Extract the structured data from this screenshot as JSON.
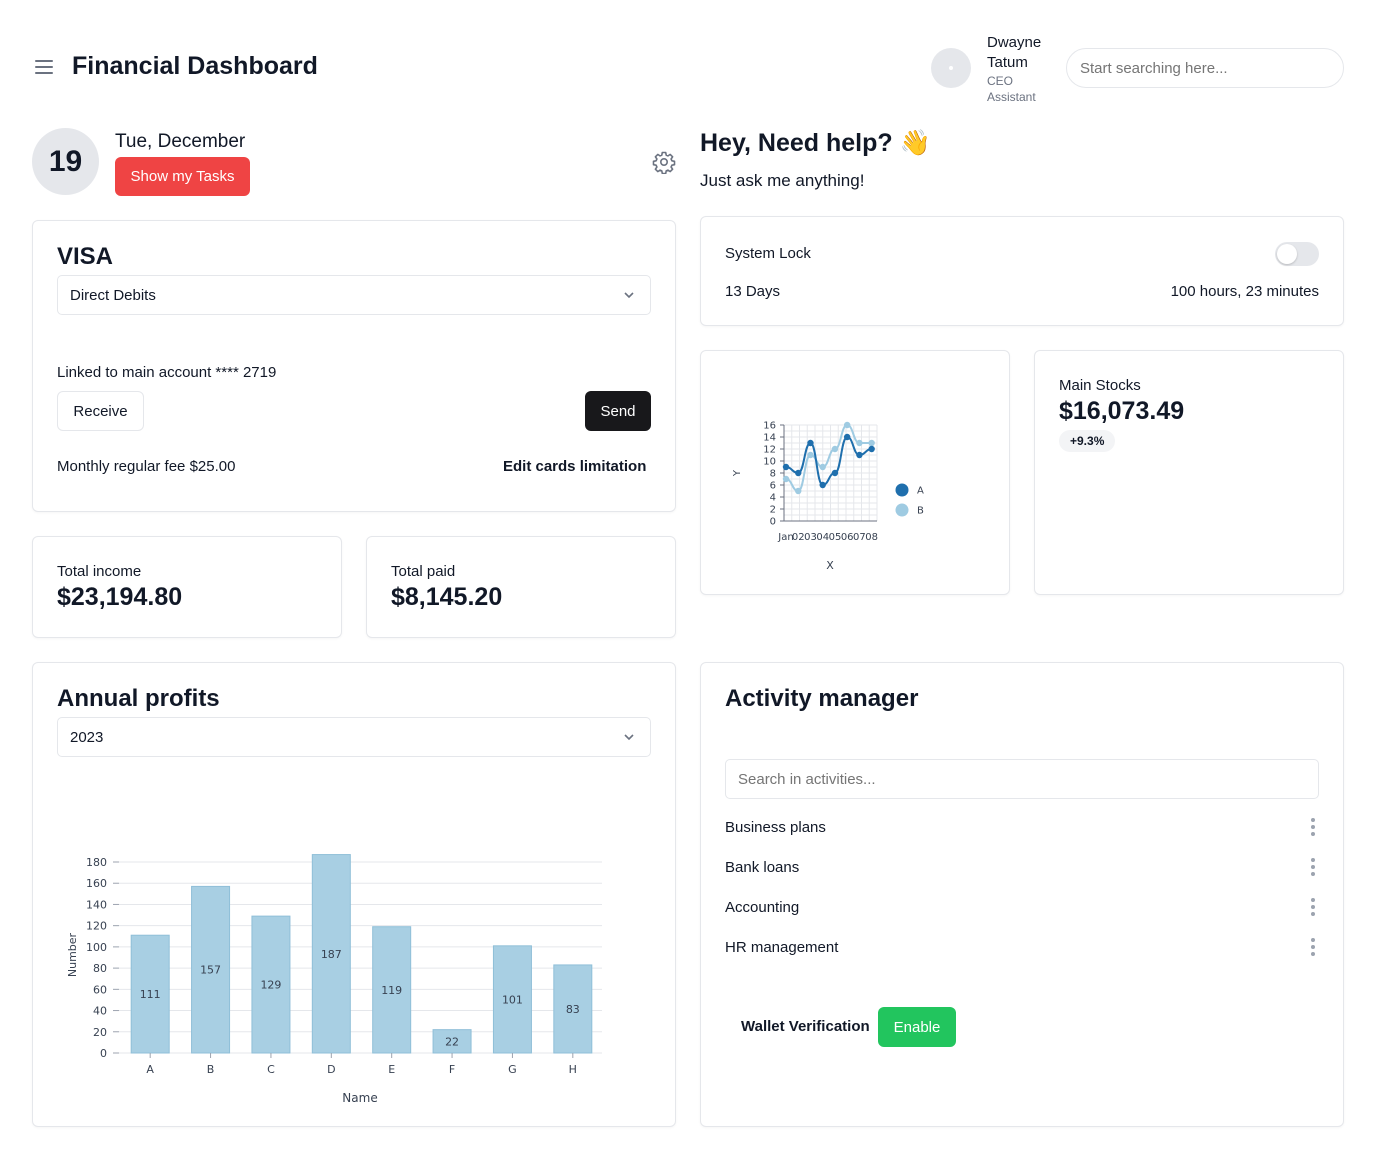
{
  "header": {
    "title": "Financial Dashboard",
    "user": {
      "first_name": "Dwayne",
      "last_name": "Tatum",
      "role_line1": "CEO",
      "role_line2": "Assistant"
    },
    "search_placeholder": "Start searching here..."
  },
  "date": {
    "day": "19",
    "label": "Tue, December",
    "tasks_button": "Show my Tasks"
  },
  "help": {
    "title": "Hey, Need help? 👋",
    "subtitle": "Just ask me anything!"
  },
  "visa": {
    "title": "VISA",
    "select_value": "Direct Debits",
    "linked": "Linked to main account **** 2719",
    "receive": "Receive",
    "send": "Send",
    "fee": "Monthly regular fee $25.00",
    "edit_limit": "Edit cards limitation"
  },
  "system_lock": {
    "label": "System Lock",
    "days": "13 Days",
    "time": "100 hours, 23 minutes",
    "enabled": false
  },
  "income": {
    "label": "Total income",
    "value": "$23,194.80"
  },
  "paid": {
    "label": "Total paid",
    "value": "$8,145.20"
  },
  "stocks": {
    "label": "Main Stocks",
    "value": "$16,073.49",
    "change": "+9.3%"
  },
  "annual": {
    "title": "Annual profits",
    "year": "2023"
  },
  "activity": {
    "title": "Activity manager",
    "search_placeholder": "Search in activities...",
    "items": [
      "Business plans",
      "Bank loans",
      "Accounting",
      "HR management"
    ],
    "wallet_label": "Wallet Verification",
    "enable": "Enable"
  },
  "colors": {
    "accent_red": "#ef4444",
    "green": "#22c55e",
    "bar": "#a8cfe3",
    "line_a": "#1f6fad",
    "line_b": "#9fcbe2"
  },
  "chart_data": [
    {
      "type": "line",
      "xlabel": "X",
      "ylabel": "Y",
      "x_tick_labels": [
        "Jan",
        "02",
        "03",
        "04",
        "05",
        "06",
        "07",
        "08"
      ],
      "ylim": [
        0,
        16
      ],
      "y_ticks": [
        0,
        2,
        4,
        6,
        8,
        10,
        12,
        14,
        16
      ],
      "grid": true,
      "legend": "right",
      "series": [
        {
          "name": "A",
          "values": [
            9,
            8,
            13,
            6,
            8,
            14,
            11,
            12
          ]
        },
        {
          "name": "B",
          "values": [
            7,
            5,
            11,
            9,
            12,
            16,
            13,
            13
          ]
        }
      ]
    },
    {
      "type": "bar",
      "categories": [
        "A",
        "B",
        "C",
        "D",
        "E",
        "F",
        "G",
        "H"
      ],
      "values": [
        111,
        157,
        129,
        187,
        119,
        22,
        101,
        83
      ],
      "xlabel": "Name",
      "ylabel": "Number",
      "ylim": [
        0,
        190
      ],
      "y_ticks": [
        0,
        20,
        40,
        60,
        80,
        100,
        120,
        140,
        160,
        180
      ],
      "grid": true
    }
  ]
}
